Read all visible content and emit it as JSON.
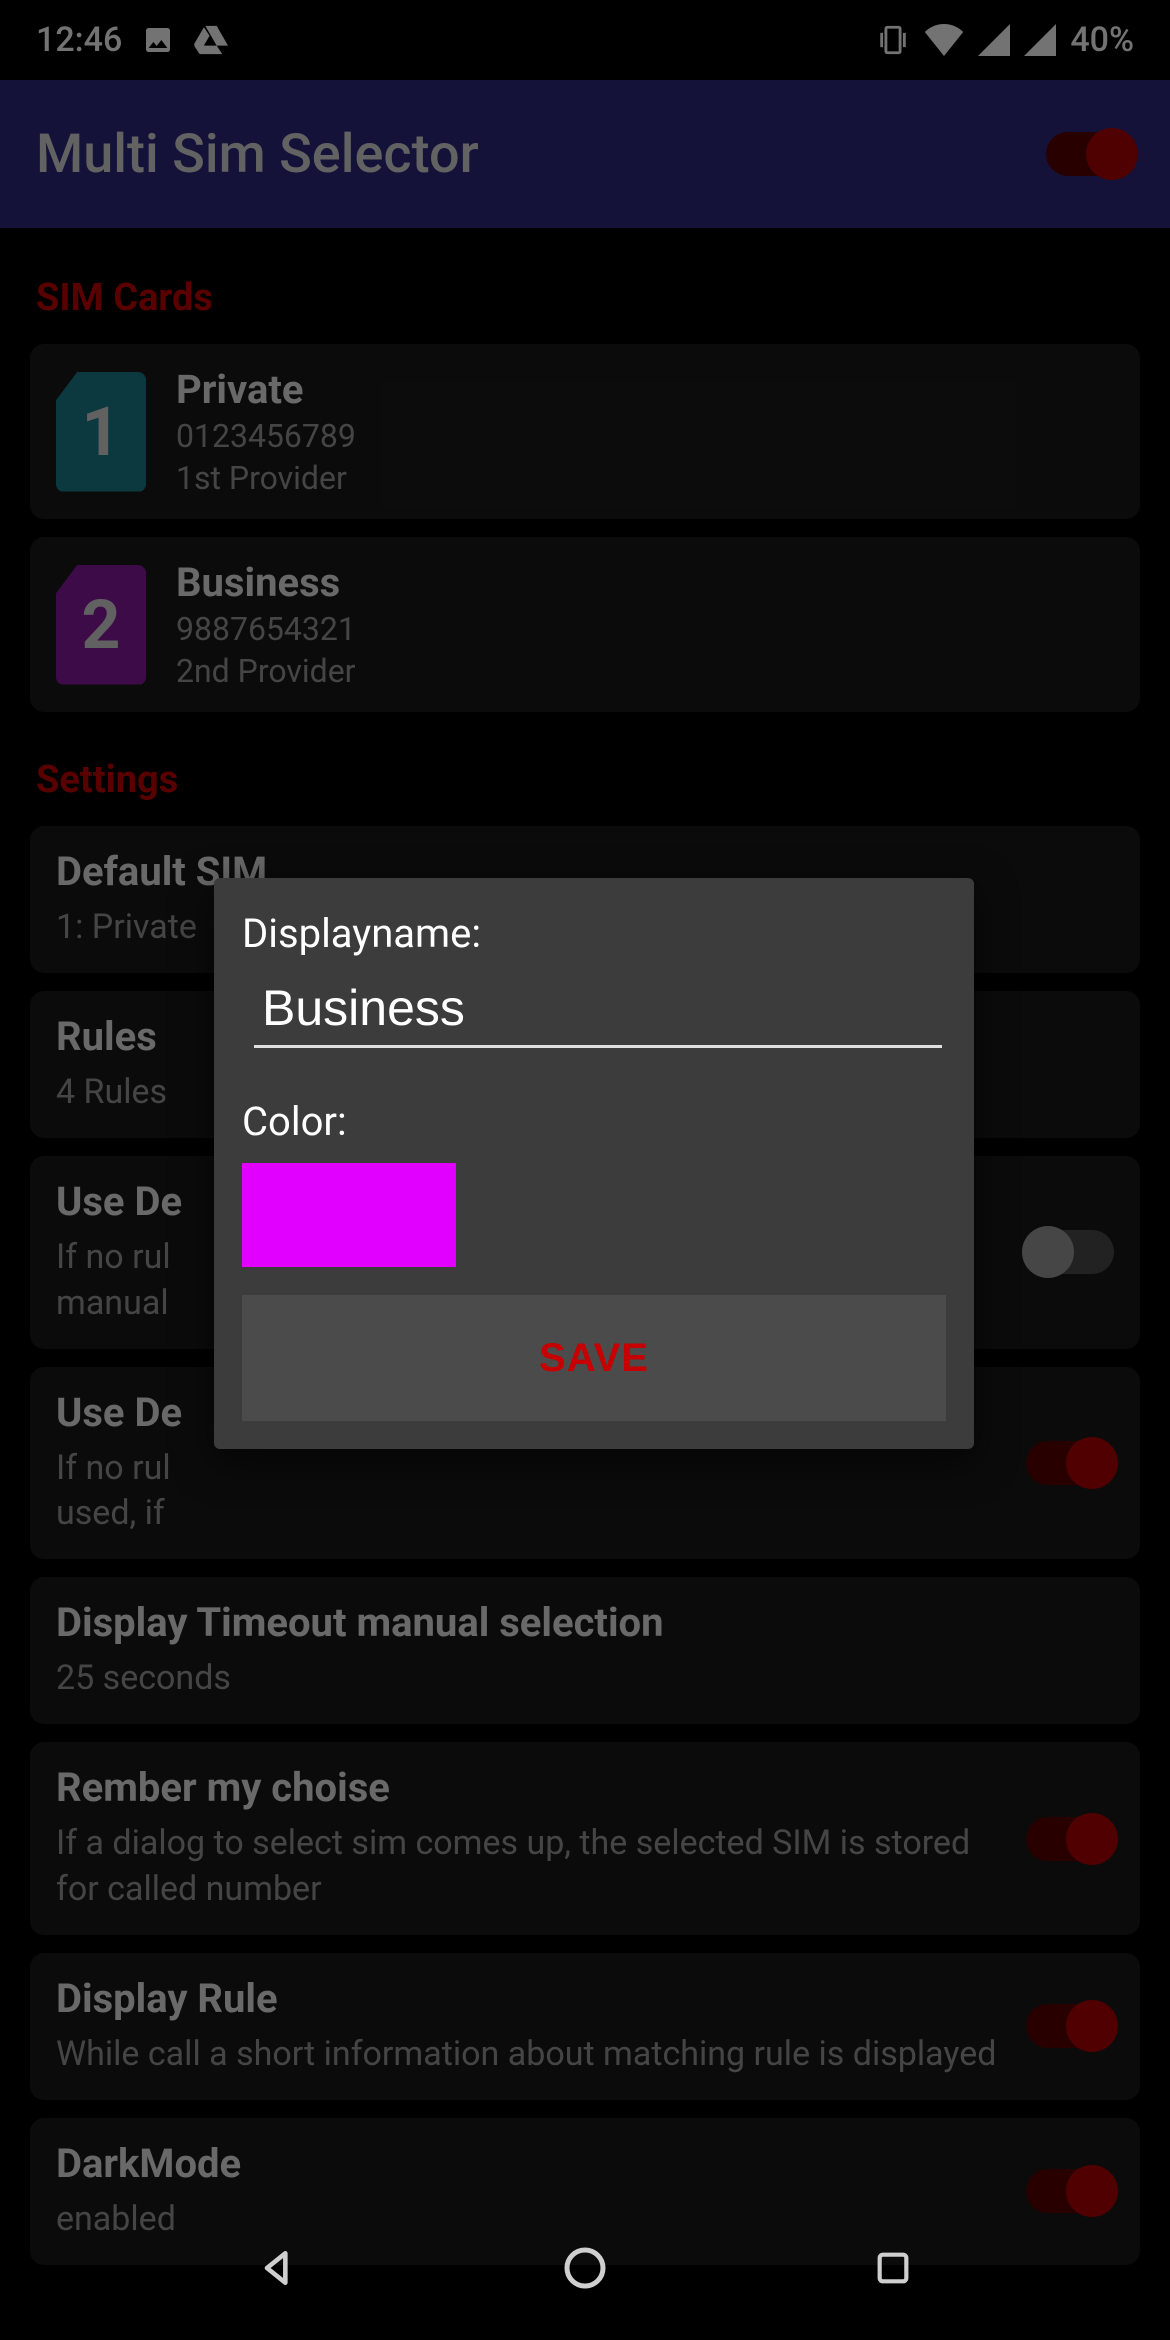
{
  "statusbar": {
    "time": "12:46",
    "battery": "40%"
  },
  "appbar": {
    "title": "Multi Sim Selector",
    "main_toggle_on": true
  },
  "sections": {
    "sim_cards_header": "SIM Cards",
    "settings_header": "Settings"
  },
  "sim_cards": [
    {
      "index": "1",
      "name": "Private",
      "number": "0123456789",
      "provider": "1st Provider",
      "color": "#1a7f8c"
    },
    {
      "index": "2",
      "name": "Business",
      "number": "9887654321",
      "provider": "2nd Provider",
      "color": "#8b1aa3"
    }
  ],
  "settings": {
    "default_sim": {
      "title": "Default SIM",
      "sub": "1: Private"
    },
    "rules": {
      "title": "Rules",
      "sub": "4 Rules"
    },
    "use_default_normal": {
      "title": "Use De",
      "sub_line1": "If no rul",
      "sub_line2": "manual",
      "toggle_on": false
    },
    "use_default_dial": {
      "title": "Use De",
      "sub_line1": "If no rul",
      "sub_line2": "used, if",
      "toggle_on": true
    },
    "display_timeout": {
      "title": "Display Timeout manual selection",
      "sub": "25 seconds"
    },
    "remember_choice": {
      "title": "Rember my choise",
      "sub": "If a dialog to select sim comes up, the selected SIM is stored for called number",
      "toggle_on": true
    },
    "display_rule": {
      "title": "Display Rule",
      "sub": "While call a short information about matching rule is displayed",
      "toggle_on": true
    },
    "darkmode": {
      "title": "DarkMode",
      "sub": "enabled",
      "toggle_on": true
    }
  },
  "dialog": {
    "displayname_label": "Displayname:",
    "displayname_value": "Business",
    "color_label": "Color:",
    "color_value": "#e100ff",
    "save_label": "SAVE"
  }
}
